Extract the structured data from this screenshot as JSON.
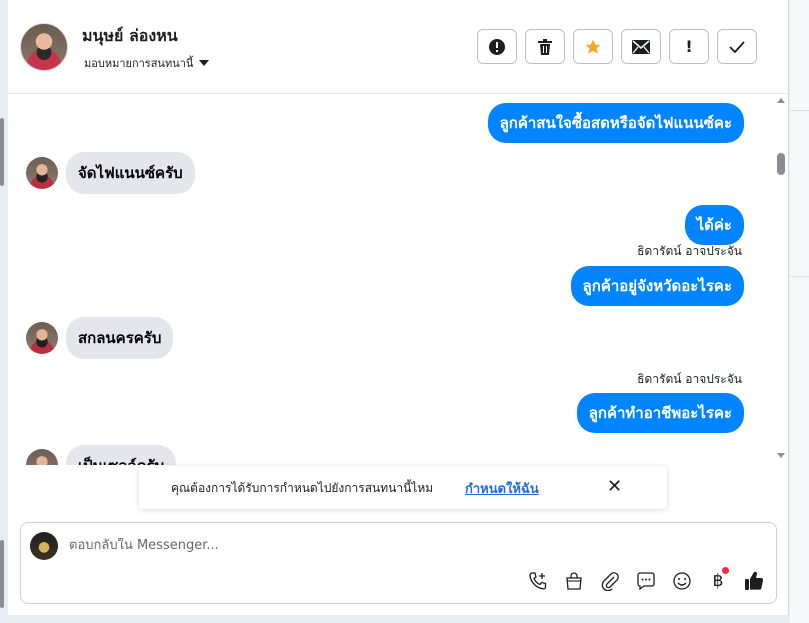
{
  "header": {
    "contact_name": "มนุษย์ ล่องหน",
    "assign_label": "มอบหมายการสนทนานี้"
  },
  "toolbar": {
    "buttons": [
      {
        "name": "spam",
        "icon": "alert-circle-icon"
      },
      {
        "name": "delete",
        "icon": "trash-icon"
      },
      {
        "name": "star",
        "icon": "star-icon"
      },
      {
        "name": "mark-unread",
        "icon": "envelope-icon"
      },
      {
        "name": "follow-up",
        "icon": "exclamation-icon"
      },
      {
        "name": "done",
        "icon": "check-icon"
      }
    ]
  },
  "messages": [
    {
      "from": "page",
      "text": "ลูกค้าสนใจซื้อสดหรือจัดไฟแนนซ์คะ"
    },
    {
      "from": "customer",
      "text": "จัดไฟแนนซ์ครับ"
    },
    {
      "from": "page",
      "text": "ได้ค่ะ"
    },
    {
      "from": "page",
      "sender": "ธิดารัตน์ อาจประจัน",
      "text": "ลูกค้าอยู่จังหวัดอะไรคะ"
    },
    {
      "from": "customer",
      "text": "สกลนครครับ"
    },
    {
      "from": "page",
      "sender": "ธิดารัตน์ อาจประจัน",
      "text": "ลูกค้าทำอาชีพอะไรคะ"
    },
    {
      "from": "customer",
      "text": "เป็นเซลล์ครับ"
    }
  ],
  "notice": {
    "text": "คุณต้องการได้รับการกำหนดไปยังการสนทนานี้ไหม",
    "link": "กำหนดให้ฉัน"
  },
  "composer": {
    "placeholder": "ตอบกลับใน Messenger...",
    "tools": [
      "call-plus-icon",
      "shopping-bag-icon",
      "paperclip-icon",
      "chat-bubble-icon",
      "smiley-icon",
      "baht-icon",
      "thumbs-up-icon"
    ]
  },
  "colors": {
    "outgoing_bubble": "#0084ff",
    "incoming_bubble": "#e4e6eb",
    "link": "#216fdb",
    "star": "#f5a623"
  }
}
